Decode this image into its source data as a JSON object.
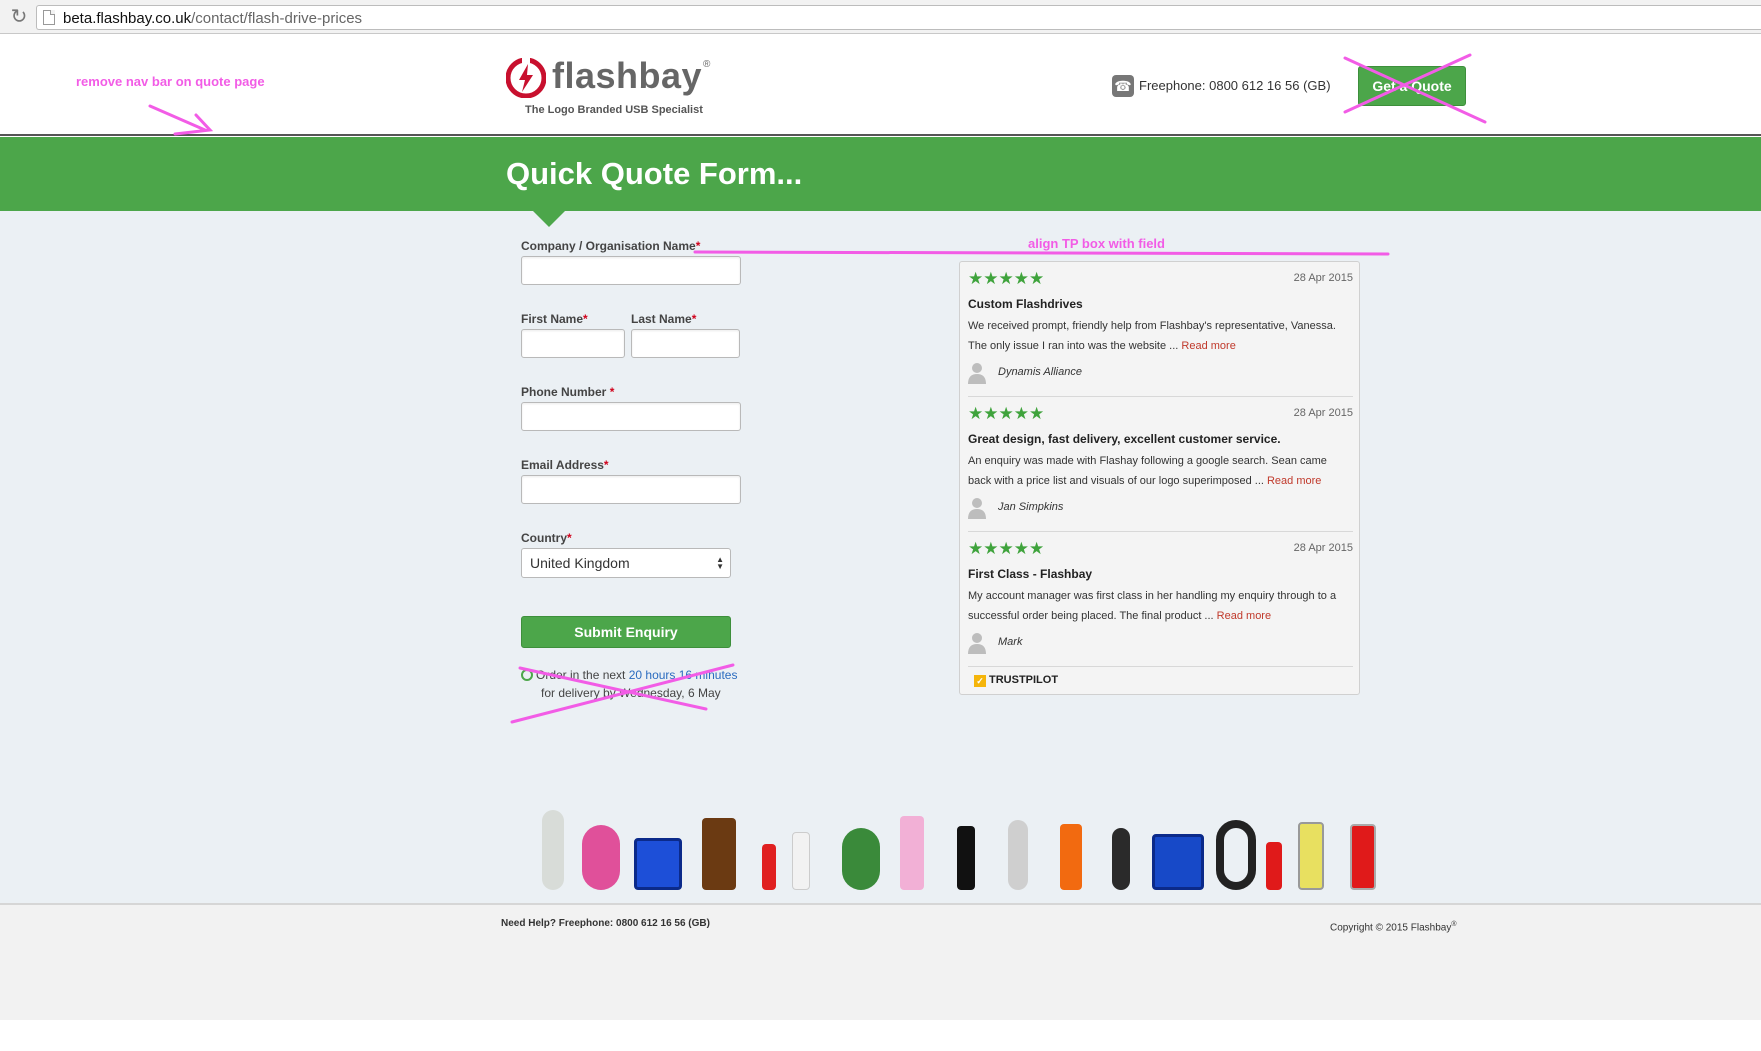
{
  "browser": {
    "url_domain": "beta.flashbay.co.uk",
    "url_path": "/contact/flash-drive-prices",
    "reload_icon": "reload-icon"
  },
  "header": {
    "logo_text": "flashbay",
    "logo_reg": "®",
    "tagline": "The Logo Branded USB Specialist",
    "phone": "Freephone: 0800 612 16 56 (GB)",
    "get_quote_label": "Get a Quote"
  },
  "annotations": {
    "nav": "remove nav bar on quote page",
    "align": "align TP box with field",
    "color": "#f25ce6"
  },
  "band": {
    "title": "Quick Quote Form...",
    "color": "#4ca64a"
  },
  "form": {
    "company_label": "Company / Organisation Name",
    "first_name_label": "First Name",
    "last_name_label": "Last Name",
    "phone_label": "Phone Number ",
    "email_label": "Email Address",
    "country_label": "Country",
    "required_mark": "*",
    "country_value": "United Kingdom",
    "submit_label": "Submit Enquiry",
    "order_prefix": "Order in the next ",
    "order_time": "20 hours 16 minutes",
    "order_delivery": "for delivery by Wednesday, 6 May"
  },
  "trustpilot": {
    "brand": "TRUSTPILOT",
    "reviews": [
      {
        "stars": "★★★★★",
        "date": "28 Apr 2015",
        "title": "Custom Flashdrives",
        "body": "We received prompt, friendly help from Flashbay's representative, Vanessa. The only issue I ran into was the website ... ",
        "read_more": "Read more",
        "author": "Dynamis Alliance"
      },
      {
        "stars": "★★★★★",
        "date": "28 Apr 2015",
        "title": "Great design, fast delivery, excellent customer service.",
        "body": "An enquiry was made with Flashay following a google search. Sean came back with a price list and visuals of our logo superimposed ... ",
        "read_more": "Read more",
        "author": "Jan Simpkins"
      },
      {
        "stars": "★★★★★",
        "date": "28 Apr 2015",
        "title": "First Class - Flashbay",
        "body": "My account manager was first class in her handling my enquiry through to a successful order being placed. The final product ... ",
        "read_more": "Read more",
        "author": "Mark"
      }
    ]
  },
  "footer": {
    "help": "Need Help? Freephone: 0800 612 16 56 (GB)",
    "copyright": "Copyright © 2015 Flashbay",
    "copyright_reg": "®"
  }
}
